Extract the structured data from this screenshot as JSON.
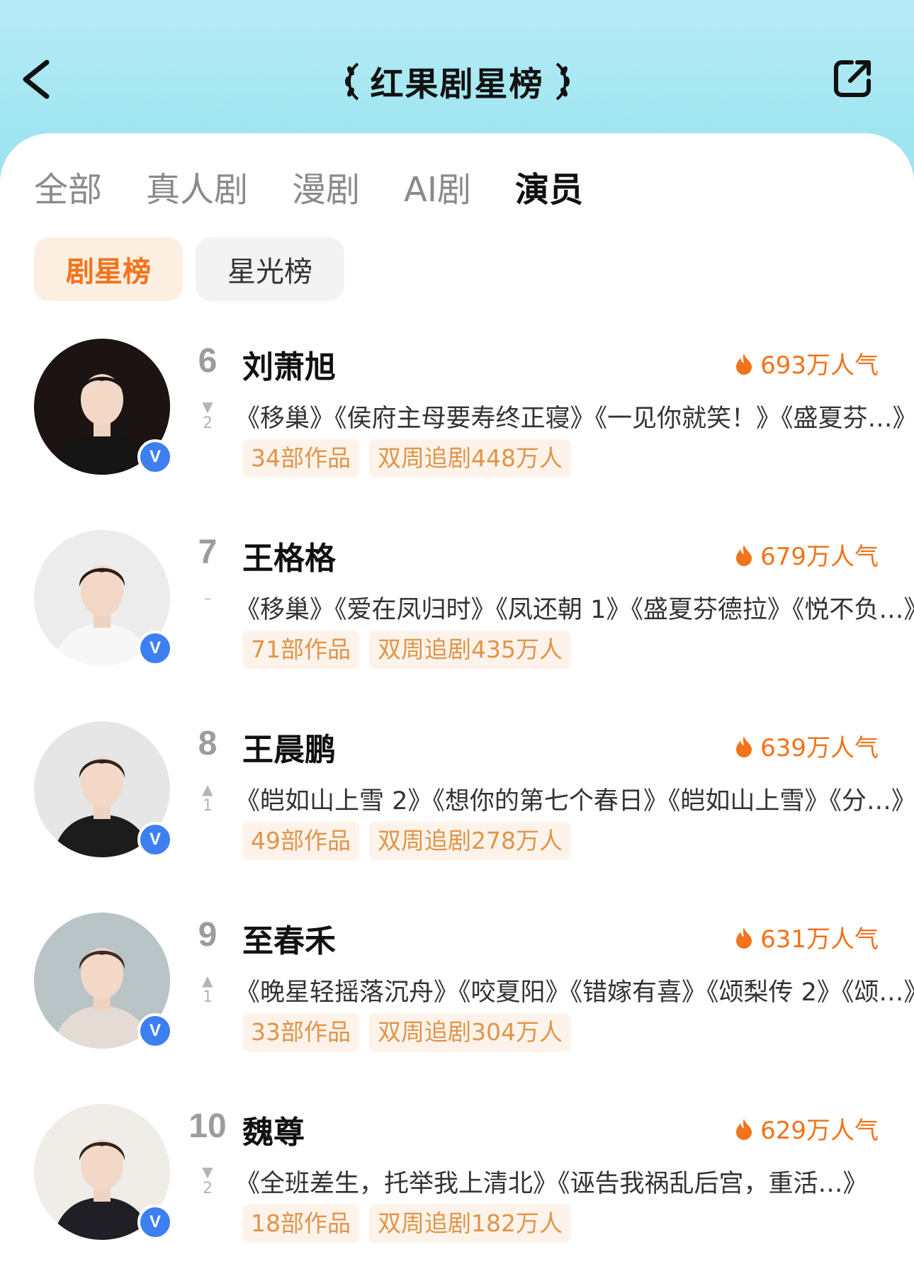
{
  "header": {
    "title": "红果剧星榜",
    "back_icon": "chevron-left-icon",
    "share_icon": "share-icon"
  },
  "tabs": [
    {
      "label": "全部"
    },
    {
      "label": "真人剧"
    },
    {
      "label": "漫剧"
    },
    {
      "label": "AI剧"
    },
    {
      "label": "演员",
      "active": true
    }
  ],
  "subtabs": [
    {
      "label": "剧星榜",
      "active": true
    },
    {
      "label": "星光榜"
    }
  ],
  "colors": {
    "accent": "#f2731a",
    "tag_bg": "#fdf3ea",
    "tag_text": "#e0944a",
    "verify": "#3d7ff0",
    "header_bg": "#a8e8f3"
  },
  "rankings": [
    {
      "rank": "6",
      "trend": "down",
      "trend_value": "2",
      "name": "刘萧旭",
      "popularity": "693万人气",
      "works": "《移巢》《侯府主母要寿终正寝》《一见你就笑！》《盛夏芬…》",
      "tags": [
        "34部作品",
        "双周追剧448万人"
      ]
    },
    {
      "rank": "7",
      "trend": "same",
      "trend_value": "",
      "name": "王格格",
      "popularity": "679万人气",
      "works": "《移巢》《爱在凤归时》《凤还朝 1》《盛夏芬德拉》《悦不负…》",
      "tags": [
        "71部作品",
        "双周追剧435万人"
      ]
    },
    {
      "rank": "8",
      "trend": "up",
      "trend_value": "1",
      "name": "王晨鹏",
      "popularity": "639万人气",
      "works": "《皑如山上雪 2》《想你的第七个春日》《皑如山上雪》《分…》",
      "tags": [
        "49部作品",
        "双周追剧278万人"
      ]
    },
    {
      "rank": "9",
      "trend": "up",
      "trend_value": "1",
      "name": "至春禾",
      "popularity": "631万人气",
      "works": "《晚星轻摇落沉舟》《咬夏阳》《错嫁有喜》《颂梨传 2》《颂…》",
      "tags": [
        "33部作品",
        "双周追剧304万人"
      ]
    },
    {
      "rank": "10",
      "trend": "down",
      "trend_value": "2",
      "name": "魏尊",
      "popularity": "629万人气",
      "works": "《全班差生，托举我上清北》《诬告我祸乱后宫，重活…》",
      "tags": [
        "18部作品",
        "双周追剧182万人"
      ]
    }
  ]
}
